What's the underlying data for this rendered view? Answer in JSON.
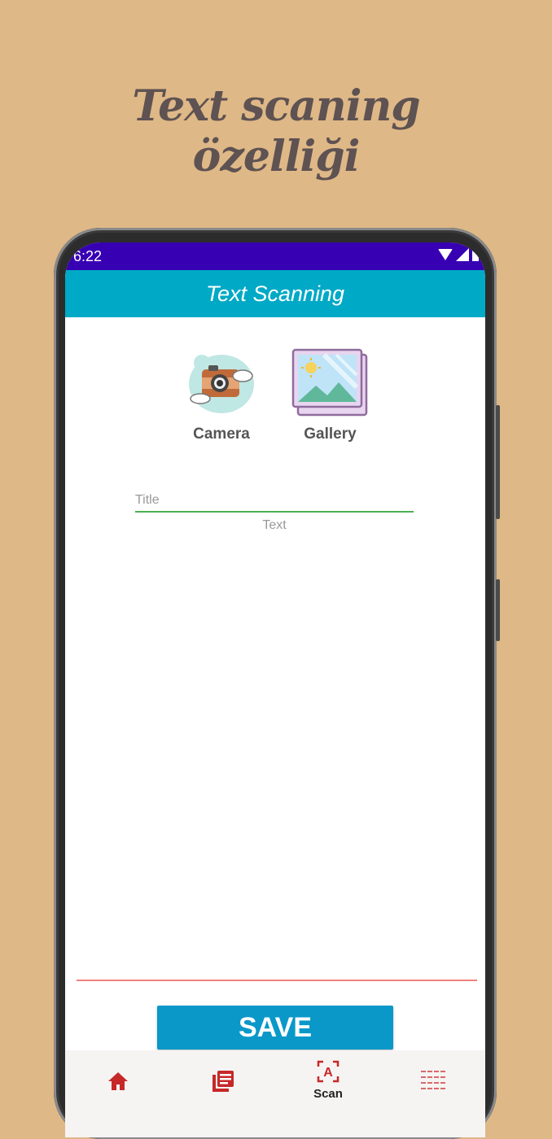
{
  "promo": {
    "title_line1": "Text scaning",
    "title_line2": "özelliği"
  },
  "status_bar": {
    "time": "6:22",
    "icons": [
      "wifi-icon",
      "signal-icon",
      "battery-icon"
    ]
  },
  "app_bar": {
    "title": "Text Scanning"
  },
  "sources": {
    "camera_label": "Camera",
    "gallery_label": "Gallery"
  },
  "form": {
    "title_placeholder": "Title",
    "text_placeholder": "Text"
  },
  "save_label": "SAVE",
  "bottom_nav": {
    "items": [
      {
        "icon": "home-icon",
        "label": ""
      },
      {
        "icon": "documents-icon",
        "label": ""
      },
      {
        "icon": "scan-text-icon",
        "label": "Scan"
      },
      {
        "icon": "grid-icon",
        "label": ""
      }
    ]
  },
  "colors": {
    "background": "#dfb887",
    "status_bar": "#3700b3",
    "app_bar": "#00a9c6",
    "save_button": "#0a98c9",
    "nav_icon": "#c62828",
    "field_underline": "#4caf50"
  }
}
